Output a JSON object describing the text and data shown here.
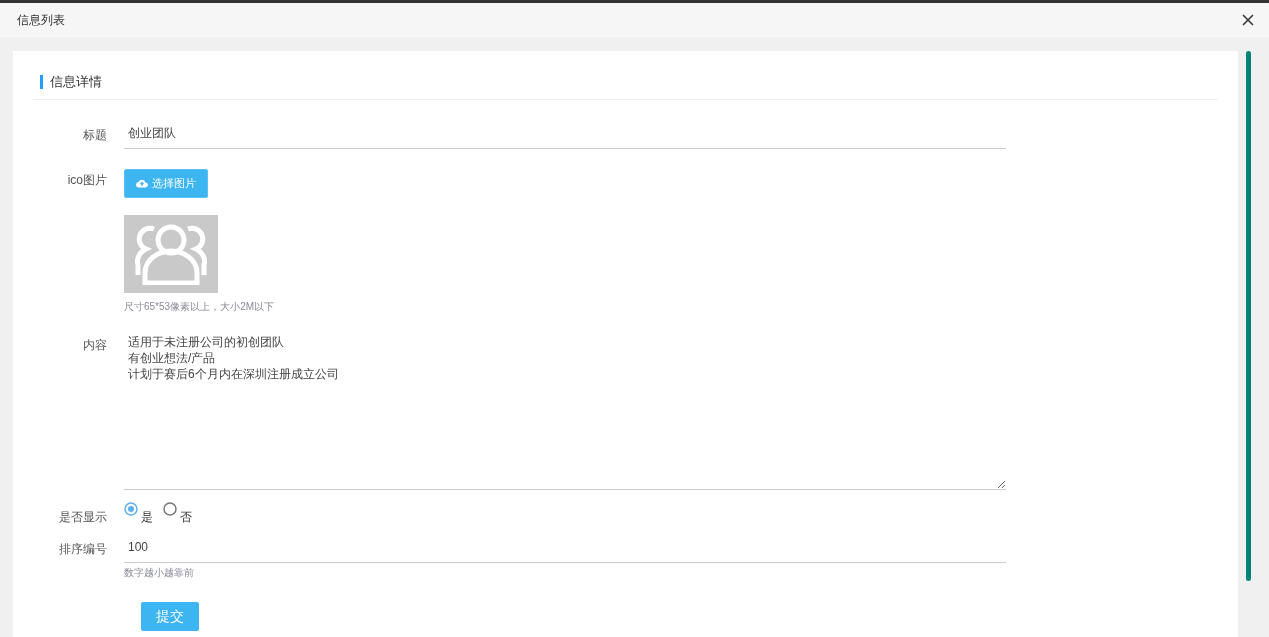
{
  "window": {
    "title": "信息列表"
  },
  "section": {
    "title": "信息详情"
  },
  "form": {
    "title_field": {
      "label": "标题",
      "value": "创业团队"
    },
    "icon_field": {
      "label": "ico图片",
      "button": "选择图片",
      "hint": "尺寸65*53像素以上，大小2M以下"
    },
    "content_field": {
      "label": "内容",
      "lines": [
        "适用于未注册公司的初创团队",
        "有创业想法/产品",
        "计划于赛后6个月内在深圳注册成立公司"
      ]
    },
    "visible_field": {
      "label": "是否显示",
      "options": [
        {
          "label": "是",
          "selected": true
        },
        {
          "label": "否",
          "selected": false
        }
      ]
    },
    "order_field": {
      "label": "排序编号",
      "value": "100",
      "hint": "数字越小越靠前"
    },
    "submit": "提交"
  }
}
